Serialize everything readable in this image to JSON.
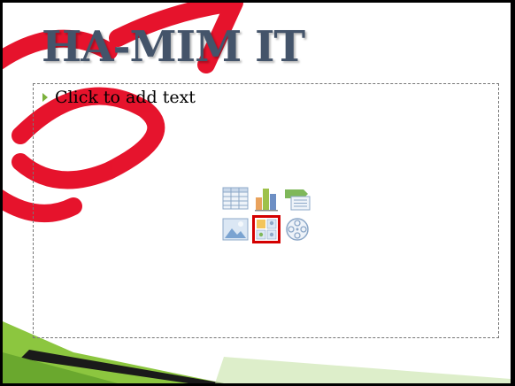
{
  "slide": {
    "title": "HA-MIM IT",
    "body_placeholder": "Click to add text"
  },
  "content_icons": [
    {
      "name": "insert-table-icon"
    },
    {
      "name": "insert-chart-icon"
    },
    {
      "name": "insert-smartart-icon"
    },
    {
      "name": "insert-picture-icon"
    },
    {
      "name": "insert-clip-art-icon",
      "selected": true
    },
    {
      "name": "insert-media-icon"
    }
  ],
  "colors": {
    "title": "#44546a",
    "accent_green": "#7bb13c",
    "watermark_red": "#e4001b",
    "selection_red": "#d40000"
  }
}
